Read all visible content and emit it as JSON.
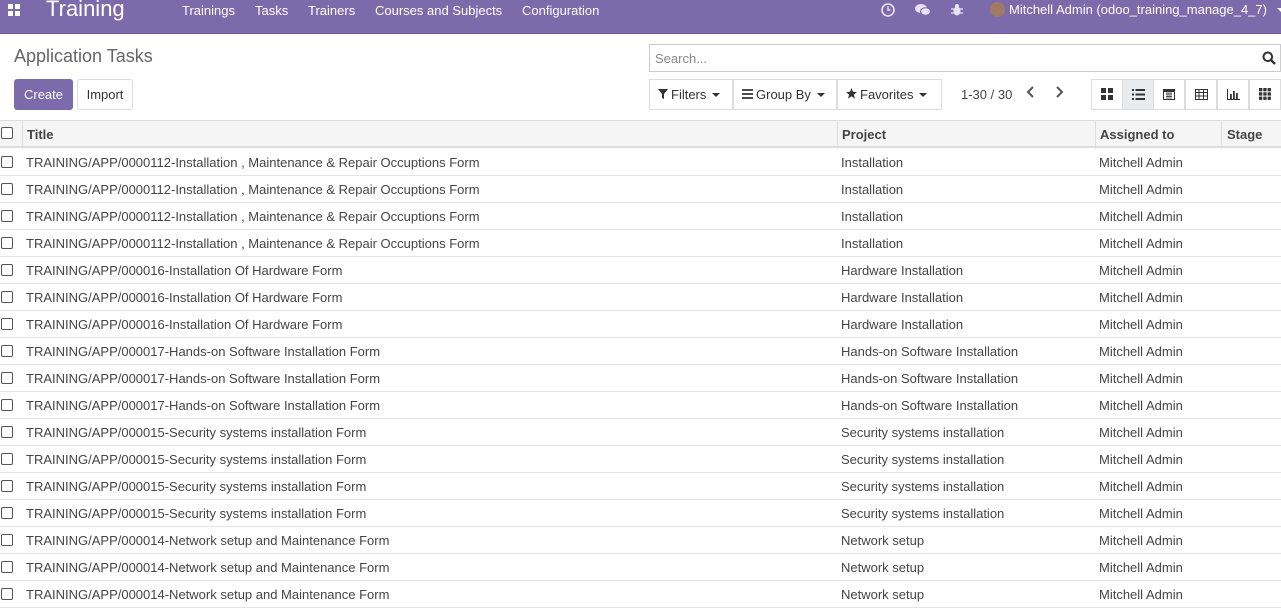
{
  "navbar": {
    "brand": "Training",
    "menu": [
      "Trainings",
      "Tasks",
      "Trainers",
      "Courses and Subjects",
      "Configuration"
    ],
    "user": "Mitchell Admin (odoo_training_manage_4_7)",
    "icons": [
      "clock-icon",
      "chat-icon",
      "bug-icon"
    ]
  },
  "control_panel": {
    "title": "Application Tasks",
    "create_label": "Create",
    "import_label": "Import",
    "search_placeholder": "Search...",
    "filters_label": "Filters",
    "groupby_label": "Group By",
    "favorites_label": "Favorites",
    "pager": "1-30 / 30",
    "views": [
      "kanban-view-icon",
      "list-view-icon",
      "calendar-view-icon",
      "pivot-view-icon",
      "graph-view-icon",
      "grid-view-icon"
    ],
    "active_view": "list-view-icon"
  },
  "table": {
    "columns": [
      "Title",
      "Project",
      "Assigned to",
      "Stage"
    ],
    "rows": [
      {
        "title": "TRAINING/APP/0000112-Installation , Maintenance & Repair Occuptions Form",
        "project": "Installation",
        "assigned": "Mitchell Admin",
        "stage": ""
      },
      {
        "title": "TRAINING/APP/0000112-Installation , Maintenance & Repair Occuptions Form",
        "project": "Installation",
        "assigned": "Mitchell Admin",
        "stage": ""
      },
      {
        "title": "TRAINING/APP/0000112-Installation , Maintenance & Repair Occuptions Form",
        "project": "Installation",
        "assigned": "Mitchell Admin",
        "stage": ""
      },
      {
        "title": "TRAINING/APP/0000112-Installation , Maintenance & Repair Occuptions Form",
        "project": "Installation",
        "assigned": "Mitchell Admin",
        "stage": ""
      },
      {
        "title": "TRAINING/APP/000016-Installation Of Hardware Form",
        "project": "Hardware Installation",
        "assigned": "Mitchell Admin",
        "stage": ""
      },
      {
        "title": "TRAINING/APP/000016-Installation Of Hardware Form",
        "project": "Hardware Installation",
        "assigned": "Mitchell Admin",
        "stage": ""
      },
      {
        "title": "TRAINING/APP/000016-Installation Of Hardware Form",
        "project": "Hardware Installation",
        "assigned": "Mitchell Admin",
        "stage": ""
      },
      {
        "title": "TRAINING/APP/000017-Hands-on Software Installation Form",
        "project": "Hands-on Software Installation",
        "assigned": "Mitchell Admin",
        "stage": ""
      },
      {
        "title": "TRAINING/APP/000017-Hands-on Software Installation Form",
        "project": "Hands-on Software Installation",
        "assigned": "Mitchell Admin",
        "stage": ""
      },
      {
        "title": "TRAINING/APP/000017-Hands-on Software Installation Form",
        "project": "Hands-on Software Installation",
        "assigned": "Mitchell Admin",
        "stage": ""
      },
      {
        "title": "TRAINING/APP/000015-Security systems installation Form",
        "project": "Security systems installation",
        "assigned": "Mitchell Admin",
        "stage": ""
      },
      {
        "title": "TRAINING/APP/000015-Security systems installation Form",
        "project": "Security systems installation",
        "assigned": "Mitchell Admin",
        "stage": ""
      },
      {
        "title": "TRAINING/APP/000015-Security systems installation Form",
        "project": "Security systems installation",
        "assigned": "Mitchell Admin",
        "stage": ""
      },
      {
        "title": "TRAINING/APP/000015-Security systems installation Form",
        "project": "Security systems installation",
        "assigned": "Mitchell Admin",
        "stage": ""
      },
      {
        "title": "TRAINING/APP/000014-Network setup and Maintenance Form",
        "project": "Network setup",
        "assigned": "Mitchell Admin",
        "stage": ""
      },
      {
        "title": "TRAINING/APP/000014-Network setup and Maintenance Form",
        "project": "Network setup",
        "assigned": "Mitchell Admin",
        "stage": ""
      },
      {
        "title": "TRAINING/APP/000014-Network setup and Maintenance Form",
        "project": "Network setup",
        "assigned": "Mitchell Admin",
        "stage": ""
      }
    ]
  },
  "colors": {
    "brand": "#7c6bab"
  }
}
